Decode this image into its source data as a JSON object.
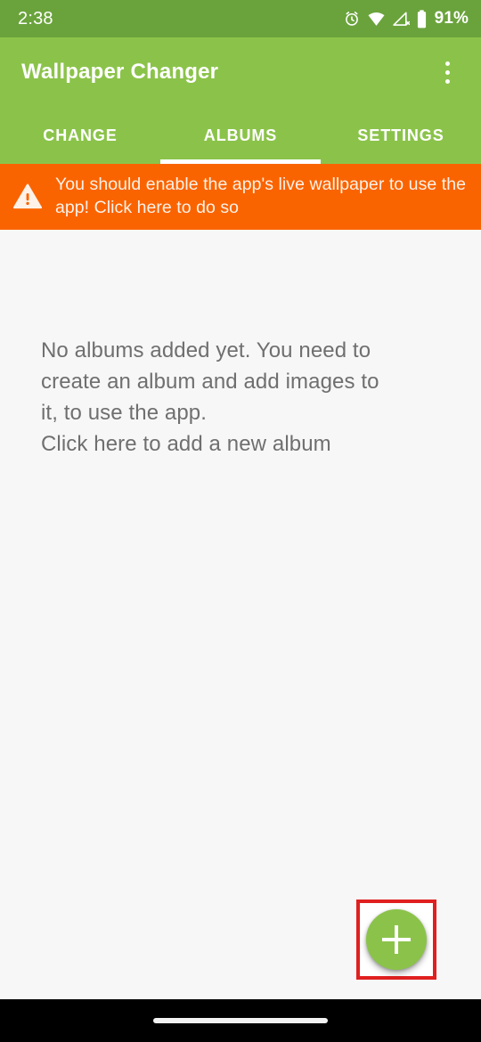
{
  "status_bar": {
    "time": "2:38",
    "battery_percent": "91%",
    "icons": [
      "alarm-clock-icon",
      "wifi-icon",
      "cellular-no-signal-icon",
      "battery-icon"
    ],
    "background_color": "#6aa33c",
    "foreground_color": "#ffffff"
  },
  "app_bar": {
    "title": "Wallpaper Changer",
    "overflow_icon": "overflow-menu-icon",
    "background_color": "#8bc34a",
    "text_color": "#ffffff"
  },
  "tabs": {
    "items": [
      {
        "label": "CHANGE",
        "active": false
      },
      {
        "label": "ALBUMS",
        "active": true
      },
      {
        "label": "SETTINGS",
        "active": false
      }
    ],
    "indicator_color": "#ffffff",
    "background_color": "#8bc34a"
  },
  "warning_banner": {
    "icon": "warning-triangle-icon",
    "text": "You should enable the app's live wallpaper to use the app! Click here to do so",
    "background_color": "#fa6400",
    "text_color": "#fdf1e8"
  },
  "empty_state": {
    "lines": [
      "No albums added yet. You need to",
      "create an album and add images to",
      "it, to use the app.",
      "Click here to add a new album"
    ],
    "text_color": "#6f6f6f"
  },
  "fab": {
    "icon": "plus-icon",
    "label": "Add new album",
    "background_color": "#8bc34a",
    "icon_color": "#ffffff",
    "highlight_color": "#e02020"
  },
  "nav_bar": {
    "gesture_pill": "gesture-pill",
    "background_color": "#000000"
  },
  "content": {
    "background_color": "#f7f7f7"
  }
}
